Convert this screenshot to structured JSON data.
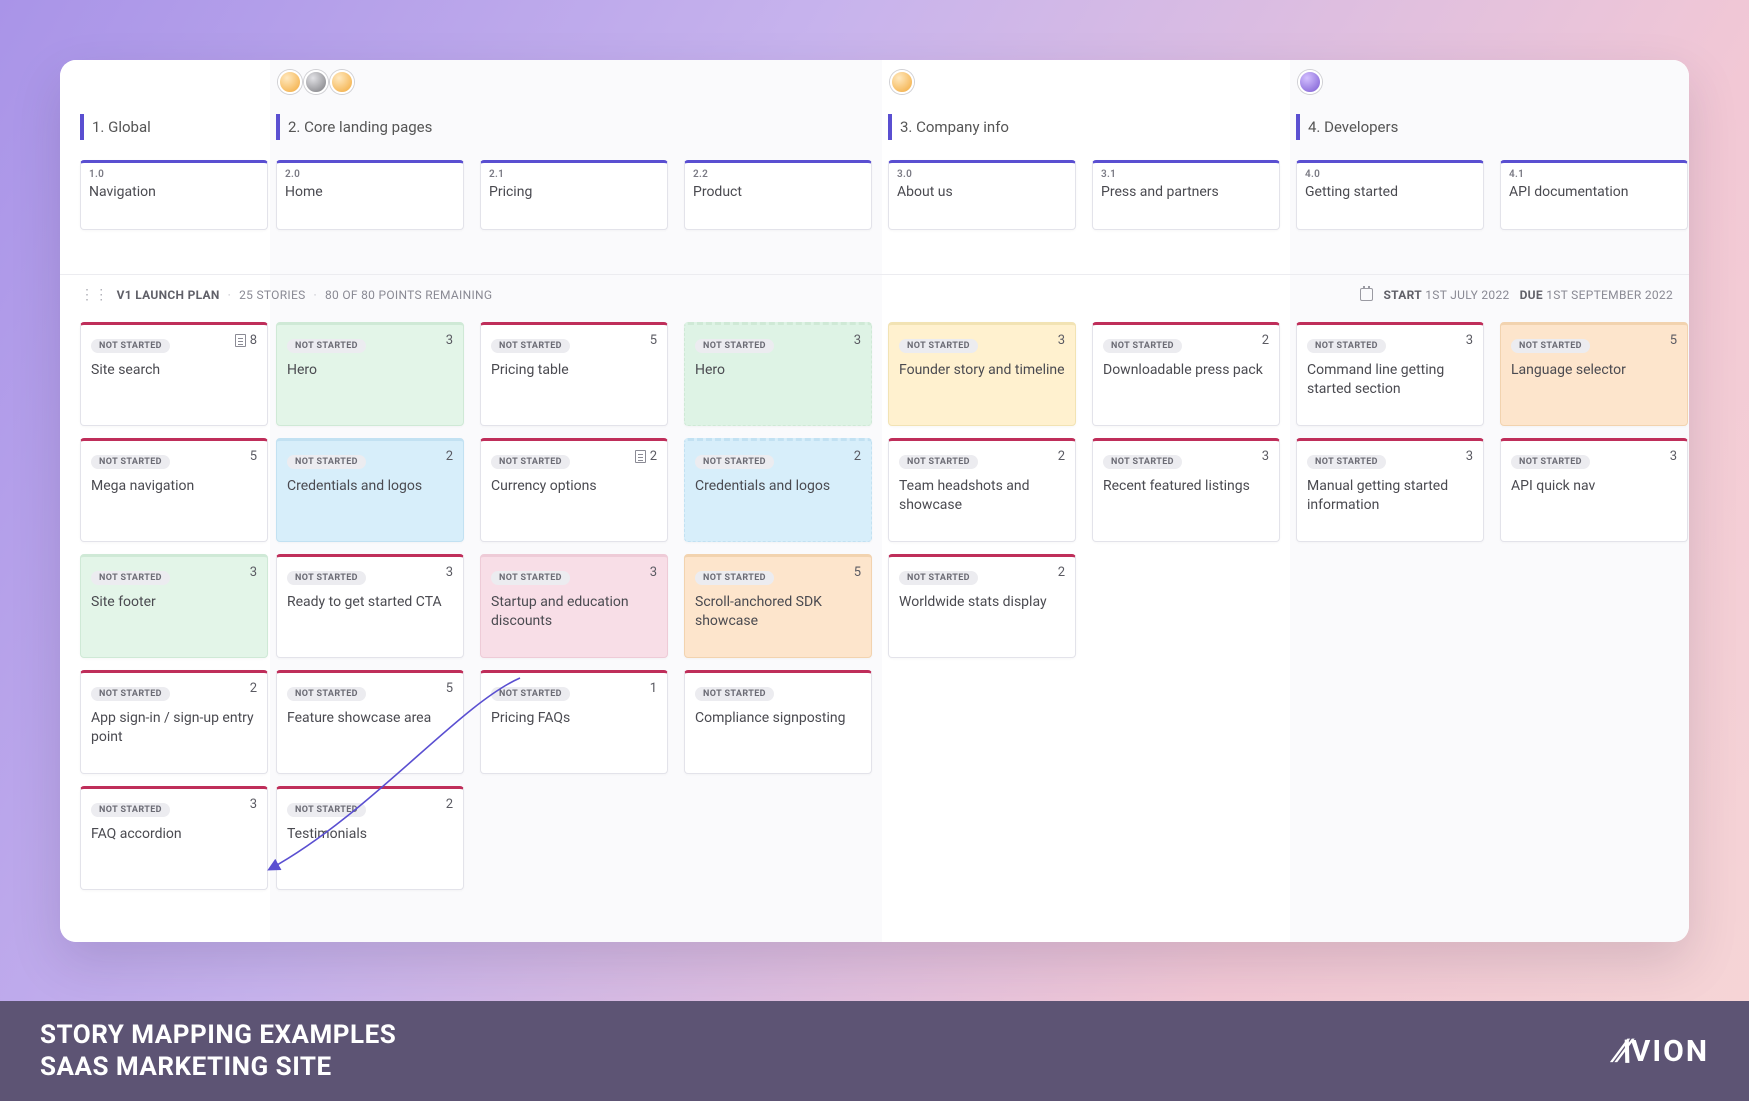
{
  "footer": {
    "title1": "STORY MAPPING EXAMPLES",
    "title2": "SAAS MARKETING SITE",
    "brand": "VION"
  },
  "release_bar": {
    "name": "V1 LAUNCH PLAN",
    "stories_count": "25 STORIES",
    "points": "80 OF 80 POINTS REMAINING",
    "start_label": "START",
    "start_date": "1ST JULY 2022",
    "due_label": "DUE",
    "due_date": "1ST SEPTEMBER 2022"
  },
  "status_text": "NOT STARTED",
  "epics": [
    {
      "label": "1. Global",
      "avatars": []
    },
    {
      "label": "2. Core landing pages",
      "avatars": [
        "orange",
        "grey",
        "orange"
      ]
    },
    {
      "label": "3. Company info",
      "avatars": [
        "orange"
      ]
    },
    {
      "label": "4. Developers",
      "avatars": [
        "purple"
      ]
    }
  ],
  "steps": [
    {
      "num": "1.0",
      "title": "Navigation"
    },
    {
      "num": "2.0",
      "title": "Home"
    },
    {
      "num": "2.1",
      "title": "Pricing"
    },
    {
      "num": "2.2",
      "title": "Product"
    },
    {
      "num": "3.0",
      "title": "About us"
    },
    {
      "num": "3.1",
      "title": "Press and partners"
    },
    {
      "num": "4.0",
      "title": "Getting started"
    },
    {
      "num": "4.1",
      "title": "API documentation"
    }
  ],
  "columns": [
    [
      {
        "title": "Site search",
        "points": "8",
        "doc": true
      },
      {
        "title": "Mega navigation",
        "points": "5"
      },
      {
        "title": "Site footer",
        "points": "3",
        "highlight": "green"
      },
      {
        "title": "App sign-in / sign-up entry point",
        "points": "2"
      },
      {
        "title": "FAQ accordion",
        "points": "3"
      }
    ],
    [
      {
        "title": "Hero",
        "points": "3",
        "highlight": "green"
      },
      {
        "title": "Credentials and logos",
        "points": "2",
        "highlight": "blue"
      },
      {
        "title": "Ready to get started CTA",
        "points": "3"
      },
      {
        "title": "Feature showcase area",
        "points": "5"
      },
      {
        "title": "Testimonials",
        "points": "2"
      }
    ],
    [
      {
        "title": "Pricing table",
        "points": "5"
      },
      {
        "title": "Currency options",
        "points": "2",
        "doc": true
      },
      {
        "title": "Startup and education discounts",
        "points": "3",
        "highlight": "pink"
      },
      {
        "title": "Pricing FAQs",
        "points": "1"
      }
    ],
    [
      {
        "title": "Hero",
        "points": "3",
        "highlight": "green2"
      },
      {
        "title": "Credentials and logos",
        "points": "2",
        "highlight": "blue2"
      },
      {
        "title": "Scroll-anchored SDK showcase",
        "points": "5",
        "highlight": "orange"
      },
      {
        "title": "Compliance signposting",
        "points": ""
      }
    ],
    [
      {
        "title": "Founder story and timeline",
        "points": "3",
        "highlight": "yellow"
      },
      {
        "title": "Team headshots and showcase",
        "points": "2"
      },
      {
        "title": "Worldwide stats display",
        "points": "2"
      }
    ],
    [
      {
        "title": "Downloadable press pack",
        "points": "2"
      },
      {
        "title": "Recent featured listings",
        "points": "3"
      }
    ],
    [
      {
        "title": "Command line getting started section",
        "points": "3"
      },
      {
        "title": "Manual getting started information",
        "points": "3"
      }
    ],
    [
      {
        "title": "Language selector",
        "points": "5",
        "highlight": "orange2"
      },
      {
        "title": "API quick nav",
        "points": "3"
      }
    ]
  ]
}
